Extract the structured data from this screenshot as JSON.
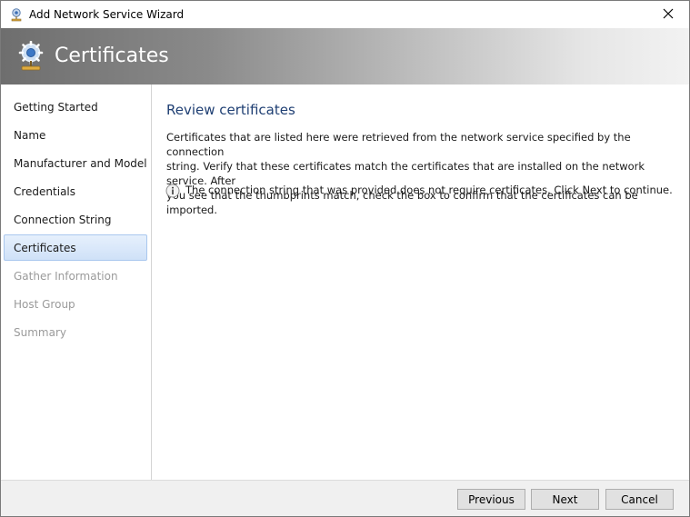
{
  "window": {
    "title": "Add Network Service Wizard",
    "icon": "network-service-icon"
  },
  "banner": {
    "title": "Certificates",
    "icon": "network-service-icon"
  },
  "nav": {
    "items": [
      {
        "label": "Getting Started",
        "state": "enabled"
      },
      {
        "label": "Name",
        "state": "enabled"
      },
      {
        "label": "Manufacturer and Model",
        "state": "enabled"
      },
      {
        "label": "Credentials",
        "state": "enabled"
      },
      {
        "label": "Connection String",
        "state": "enabled"
      },
      {
        "label": "Certificates",
        "state": "selected"
      },
      {
        "label": "Gather Information",
        "state": "disabled"
      },
      {
        "label": "Host Group",
        "state": "disabled"
      },
      {
        "label": "Summary",
        "state": "disabled"
      }
    ]
  },
  "content": {
    "heading": "Review certificates",
    "description_lines": [
      "Certificates that are listed here were retrieved from the network service specified by the connection",
      "string. Verify that these certificates match the certificates that are installed on the network service. After",
      "you see that the thumbprints match, check the box to confirm that the certificates can be imported."
    ],
    "info_icon": "info-icon",
    "info_text": "The connection string that was provided does not require certificates. Click Next to continue."
  },
  "footer": {
    "previous_label": "Previous",
    "next_label": "Next",
    "cancel_label": "Cancel"
  },
  "colors": {
    "heading": "#1f3f73",
    "selected_item_bg": "#cfe1f8",
    "selected_item_border": "#a9c7ee",
    "disabled_text": "#9a9a9a"
  }
}
